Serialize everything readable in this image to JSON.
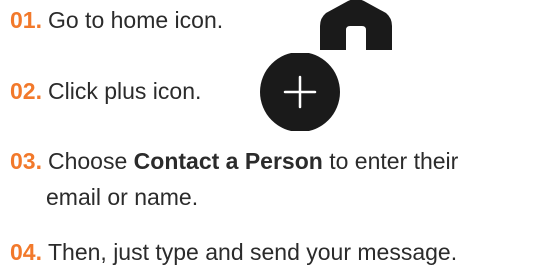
{
  "steps": [
    {
      "num": "01.",
      "text": "Go to home icon."
    },
    {
      "num": "02.",
      "text": "Click plus icon."
    },
    {
      "num": "03.",
      "text_before": "Choose ",
      "bold": "Contact a Person",
      "text_after": " to enter their",
      "continuation": "email or name."
    },
    {
      "num": "04.",
      "text": "Then, just type and send your message."
    }
  ],
  "icons": {
    "home": "home-icon",
    "plus": "plus-icon"
  },
  "colors": {
    "number_accent": "#f2792b",
    "text": "#2b2b2b",
    "icon": "#1a1a1a"
  }
}
